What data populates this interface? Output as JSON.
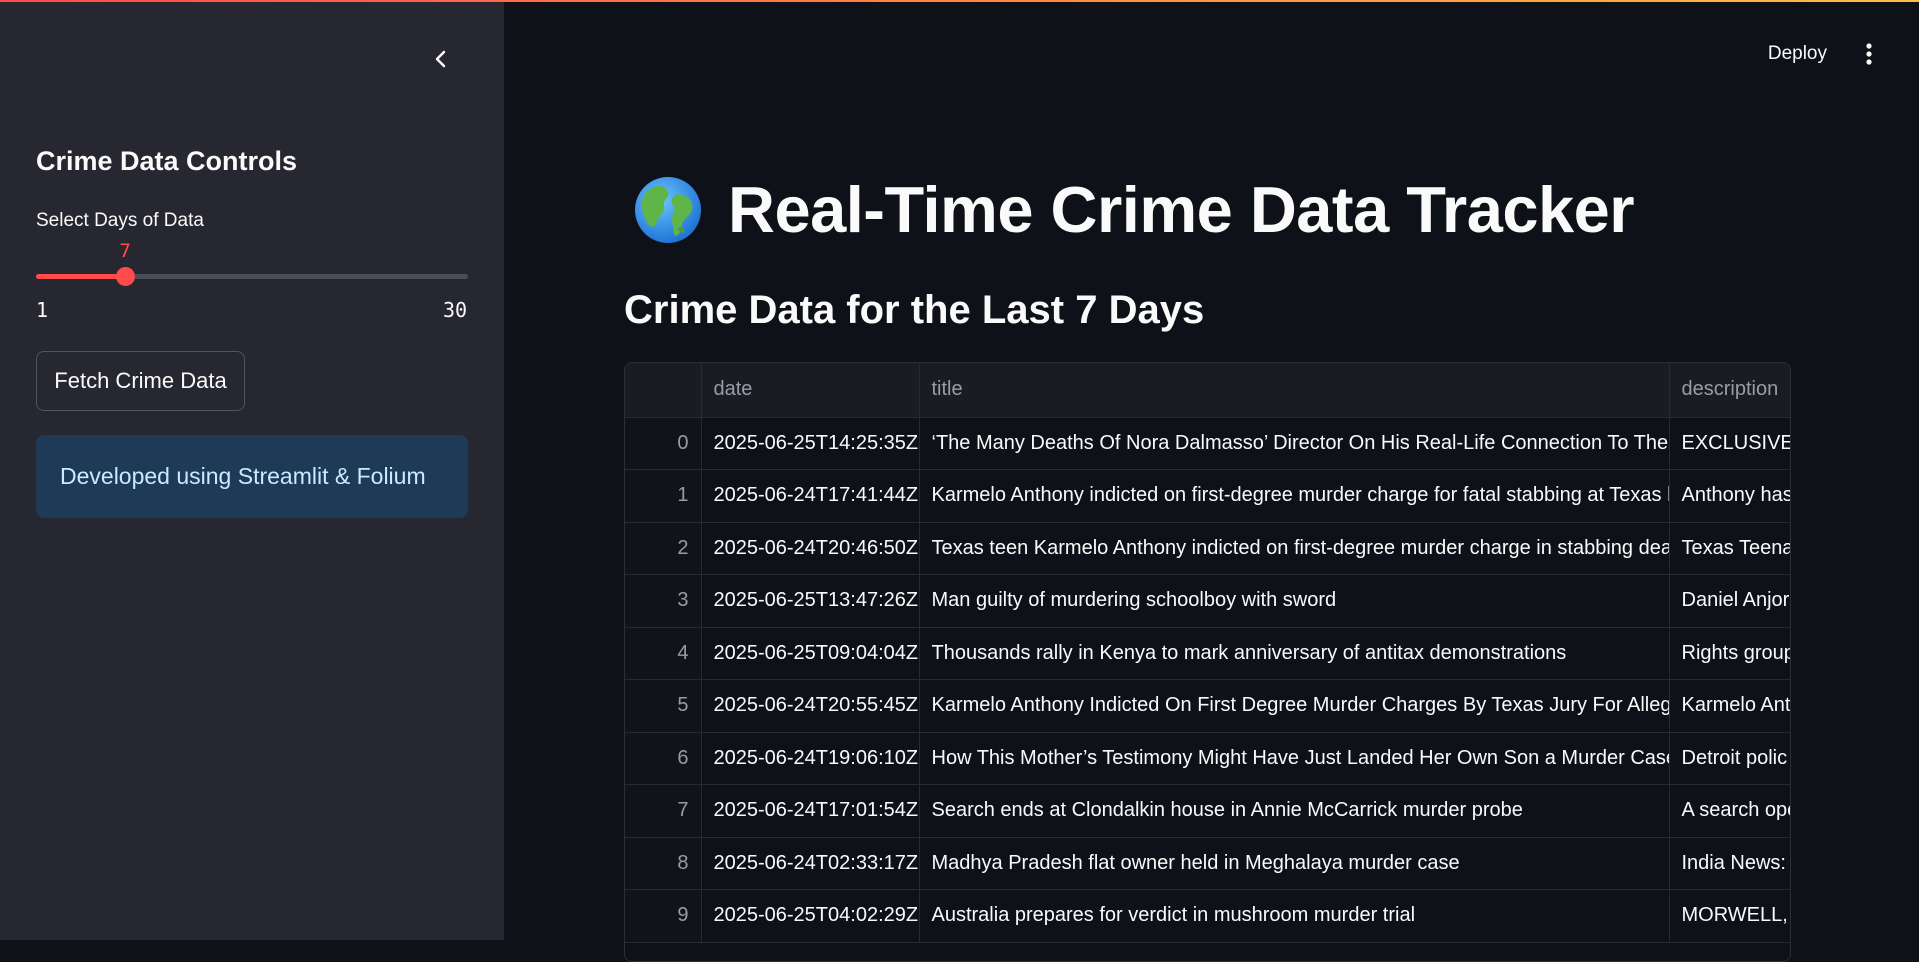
{
  "app": {
    "accent_color": "#ff4b4b",
    "background_color": "#0e1117",
    "sidebar_color": "#262730"
  },
  "header": {
    "deploy_label": "Deploy",
    "menu_icon": "kebab-menu-icon"
  },
  "sidebar": {
    "collapse_icon": "chevron-left-icon",
    "title": "Crime Data Controls",
    "slider": {
      "label": "Select Days of Data",
      "value": 7,
      "value_text": "7",
      "min": 1,
      "max": 30,
      "min_text": "1",
      "max_text": "30"
    },
    "fetch_button_label": "Fetch Crime Data",
    "info_text": "Developed using Streamlit & Folium"
  },
  "main": {
    "title_icon": "globe-icon",
    "title": "Real-Time Crime Data Tracker",
    "subtitle": "Crime Data for the Last 7 Days",
    "table": {
      "columns": [
        "",
        "date",
        "title",
        "description"
      ],
      "rows": [
        {
          "index": "0",
          "date": "2025-06-25T14:25:35Z",
          "title": "‘The Many Deaths Of Nora Dalmasso’ Director On His Real-Life Connection To The Ser",
          "description": "EXCLUSIVE: T"
        },
        {
          "index": "1",
          "date": "2025-06-24T17:41:44Z",
          "title": "Karmelo Anthony indicted on first-degree murder charge for fatal stabbing at Texas hi",
          "description": "Anthony has"
        },
        {
          "index": "2",
          "date": "2025-06-24T20:46:50Z",
          "title": "Texas teen Karmelo Anthony indicted on first-degree murder charge in stabbing death",
          "description": "Texas Teenag"
        },
        {
          "index": "3",
          "date": "2025-06-25T13:47:26Z",
          "title": "Man guilty of murdering schoolboy with sword",
          "description": "Daniel Anjori"
        },
        {
          "index": "4",
          "date": "2025-06-25T09:04:04Z",
          "title": "Thousands rally in Kenya to mark anniversary of antitax demonstrations",
          "description": "Rights group"
        },
        {
          "index": "5",
          "date": "2025-06-24T20:55:45Z",
          "title": "Karmelo Anthony Indicted On First Degree Murder Charges By Texas Jury For Alleged",
          "description": "Karmelo Ant"
        },
        {
          "index": "6",
          "date": "2025-06-24T19:06:10Z",
          "title": "How This Mother’s Testimony Might Have Just Landed Her Own Son a Murder Case",
          "description": "Detroit polic"
        },
        {
          "index": "7",
          "date": "2025-06-24T17:01:54Z",
          "title": "Search ends at Clondalkin house in Annie McCarrick murder probe",
          "description": "A search ope"
        },
        {
          "index": "8",
          "date": "2025-06-24T02:33:17Z",
          "title": "Madhya Pradesh flat owner held in Meghalaya murder case",
          "description": "India News: S"
        },
        {
          "index": "9",
          "date": "2025-06-25T04:02:29Z",
          "title": "Australia prepares for verdict in mushroom murder trial",
          "description": "MORWELL, A"
        }
      ]
    }
  }
}
